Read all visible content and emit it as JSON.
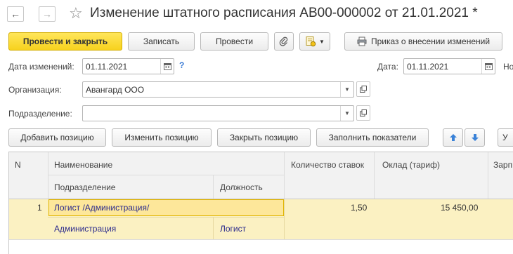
{
  "window": {
    "title": "Изменение штатного расписания АВ00-000002 от 21.01.2021 *"
  },
  "toolbar": {
    "post_close_label": "Провести и закрыть",
    "save_label": "Записать",
    "post_label": "Провести",
    "order_label": "Приказ о внесении изменений"
  },
  "form": {
    "change_date_label": "Дата изменений:",
    "change_date_value": "01.11.2021",
    "help_mark": "?",
    "date_label": "Дата:",
    "date_value": "01.11.2021",
    "number_label_partial": "Но",
    "org_label": "Организация:",
    "org_value": "Авангард ООО",
    "division_label": "Подразделение:",
    "division_value": ""
  },
  "actions": {
    "add_label": "Добавить позицию",
    "change_label": "Изменить позицию",
    "close_label": "Закрыть позицию",
    "fill_label": "Заполнить показатели",
    "partial_label": "У"
  },
  "table": {
    "headers": {
      "n": "N",
      "name": "Наименование",
      "division": "Подразделение",
      "position": "Должность",
      "rates": "Количество ставок",
      "salary": "Оклад (тариф)",
      "wage_partial": "Зарп"
    },
    "rows": [
      {
        "n": "1",
        "name": "Логист /Администрация/",
        "division": "Администрация",
        "position": "Логист",
        "rates": "1,50",
        "salary": "15 450,00"
      }
    ]
  },
  "colors": {
    "accent_yellow": "#f7d21e",
    "selected_row": "#fbf1c2",
    "link_blue": "#2a2a8c"
  }
}
